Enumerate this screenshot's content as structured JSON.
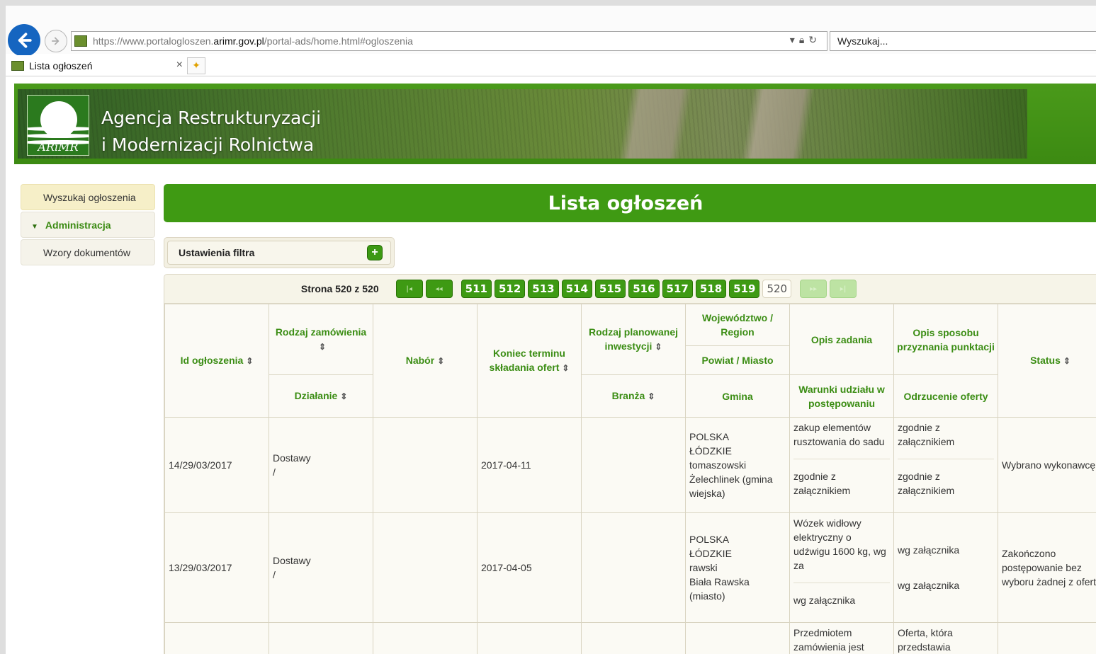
{
  "browser": {
    "url_prefix": "https://www.portalogloszen.",
    "url_domain": "arimr.gov.pl",
    "url_path": "/portal-ads/home.html#ogloszenia",
    "search_placeholder": "Wyszukaj...",
    "tab_title": "Lista ogłoszeń",
    "tab_close": "×"
  },
  "banner": {
    "line1": "Agencja Restrukturyzacji",
    "line2": "i Modernizacji Rolnictwa",
    "logo_text": "ARiMR"
  },
  "sidebar": {
    "items": [
      {
        "label": "Wyszukaj ogłoszenia"
      },
      {
        "label": "Administracja"
      },
      {
        "label": "Wzory dokumentów"
      }
    ]
  },
  "main": {
    "title": "Lista ogłoszeń",
    "filter_label": "Ustawienia filtra",
    "filter_button": "+"
  },
  "pager": {
    "label": "Strona 520 z 520",
    "first": "|◂",
    "prev": "◂◂",
    "next": "▸▸",
    "last": "▸|",
    "pages": [
      "511",
      "512",
      "513",
      "514",
      "515",
      "516",
      "517",
      "518",
      "519"
    ],
    "current": "520"
  },
  "table": {
    "headers": {
      "id": "Id ogłoszenia",
      "rodzaj_zamowienia": "Rodzaj zamówienia",
      "dzialanie": "Działanie",
      "nabor": "Nabór",
      "koniec_terminu": "Koniec terminu składania ofert",
      "rodzaj_inwestycji": "Rodzaj planowanej inwestycji",
      "branza": "Branża",
      "wojewodztwo": "Województwo / Region",
      "powiat": "Powiat / Miasto",
      "gmina": "Gmina",
      "opis_zadania": "Opis zadania",
      "warunki": "Warunki udziału w postępowaniu",
      "opis_punktacji": "Opis sposobu przyznania punktacji",
      "odrzucenie": "Odrzucenie oferty",
      "status": "Status",
      "sort_glyph": "⇕"
    },
    "rows": [
      {
        "id": "14/29/03/2017",
        "rodzaj": "Dostawy",
        "rodzaj2": "/",
        "nabor": "",
        "koniec": "2017-04-11",
        "inwestycja": "",
        "lokalizacja": [
          "POLSKA",
          "ŁÓDZKIE",
          "tomaszowski",
          "Żelechlinek (gmina",
          "wiejska)"
        ],
        "opis_zadania": "zakup elementów rusztowania do sadu",
        "warunki": "zgodnie z załącznikiem",
        "punktacja": "zgodnie z załącznikiem",
        "odrzucenie": "zgodnie z załącznikiem",
        "status": "Wybrano wykonawcę"
      },
      {
        "id": "13/29/03/2017",
        "rodzaj": "Dostawy",
        "rodzaj2": "/",
        "nabor": "",
        "koniec": "2017-04-05",
        "inwestycja": "",
        "lokalizacja": [
          "POLSKA",
          "ŁÓDZKIE",
          "rawski",
          "Biała Rawska",
          "(miasto)"
        ],
        "opis_zadania": "Wózek widłowy elektryczny o udźwigu 1600 kg, wg za",
        "warunki": "wg załącznika",
        "punktacja": "wg załącznika",
        "odrzucenie": "wg załącznika",
        "status": "Zakończono postępowanie bez wyboru żadnej z ofert"
      },
      {
        "id": "",
        "rodzaj": "",
        "rodzaj2": "",
        "nabor": "",
        "koniec": "",
        "inwestycja": "",
        "lokalizacja": [],
        "opis_zadania": "Przedmiotem zamówienia jest",
        "warunki": "",
        "punktacja": "Oferta, która przedstawia",
        "odrzucenie": "",
        "status": ""
      }
    ]
  },
  "colors": {
    "brand_green": "#3f9a13",
    "header_text_green": "#3b8d14",
    "browser_back_blue": "#1565c0"
  }
}
